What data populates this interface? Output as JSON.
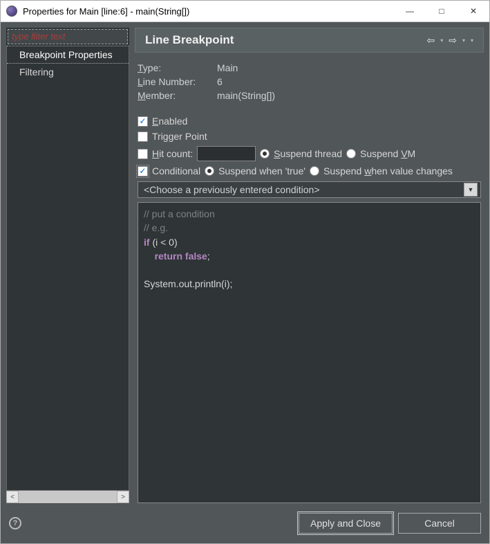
{
  "window": {
    "title": "Properties for Main [line:6] - main(String[])"
  },
  "sidebar": {
    "filter_placeholder": "type filter text",
    "items": [
      {
        "label": "Breakpoint Properties",
        "selected": true
      },
      {
        "label": "Filtering",
        "selected": false
      }
    ]
  },
  "header": {
    "title": "Line Breakpoint"
  },
  "fields": {
    "type_label": "Type:",
    "type_value": "Main",
    "line_label": "Line Number:",
    "line_value": "6",
    "member_label": "Member:",
    "member_value": "main(String[])"
  },
  "options": {
    "enabled_label": "Enabled",
    "enabled_checked": true,
    "trigger_label": "Trigger Point",
    "trigger_checked": false,
    "hit_count_label": "Hit count:",
    "hit_count_checked": false,
    "hit_count_value": "",
    "suspend_thread_label": "Suspend thread",
    "suspend_thread_on": true,
    "suspend_vm_label": "Suspend VM",
    "suspend_vm_on": false,
    "conditional_label": "Conditional",
    "conditional_checked": true,
    "suspend_true_label": "Suspend when 'true'",
    "suspend_true_on": true,
    "suspend_changes_label": "Suspend when value changes",
    "suspend_changes_on": false,
    "dropdown_label": "<Choose a previously entered condition>"
  },
  "code": {
    "line1": "// put a condition",
    "line2": "// e.g.",
    "line3_kw": "if",
    "line3_rest": " (i < 0)",
    "line4_kw": "return false",
    "line4_rest": ";",
    "line5": "System.out.println(i);"
  },
  "footer": {
    "apply_label": "Apply and Close",
    "cancel_label": "Cancel"
  }
}
